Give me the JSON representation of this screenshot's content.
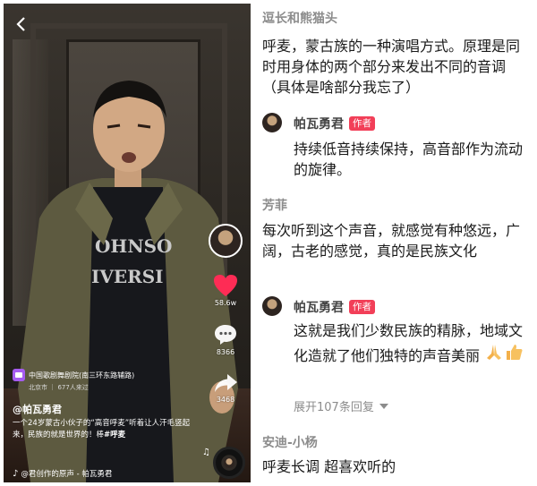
{
  "video": {
    "back_icon": "back-arrow-icon",
    "likes": "58.6w",
    "comments_count": "8366",
    "shares": "3468",
    "location_name": "中国歌剧舞剧院(南三环东路辅路)",
    "location_sub": "北京市 ｜ 677人来过",
    "author": "@帕瓦勇君",
    "caption": "一个24岁蒙古小伙子的“高音呼麦”听着让人汗毛竖起来，民族的就是世界的！棒",
    "hashtag": "#呼麦",
    "music": "@君创作的原声 - 帕瓦勇君",
    "like_color": "#fe2c55"
  },
  "comments": {
    "c1_user": "逗长和熊猫头",
    "c1_text": "呼麦，蒙古族的一种演唱方式。原理是同时用身体的两个部分来发出不同的音调（具体是啥部分我忘了）",
    "r1_user": "帕瓦勇君",
    "r1_badge": "作者",
    "r1_text": "持续低音持续保持，高音部作为流动的旋律。",
    "c2_user": "芳菲",
    "c2_text": "每次听到这个声音，就感觉有种悠远，广阔，古老的感觉，真的是民族文化",
    "r2_user": "帕瓦勇君",
    "r2_badge": "作者",
    "r2_text": "这就是我们少数民族的精脉，地域文化造就了他们独特的声音美丽",
    "r2_emojis": [
      "pray-hands-icon",
      "thumbs-up-icon"
    ],
    "expand_label": "展开107条回复",
    "c3_user": "安迪-小杨",
    "c3_text": "呼麦长调 超喜欢听的",
    "badge_color": "#f23f58"
  }
}
